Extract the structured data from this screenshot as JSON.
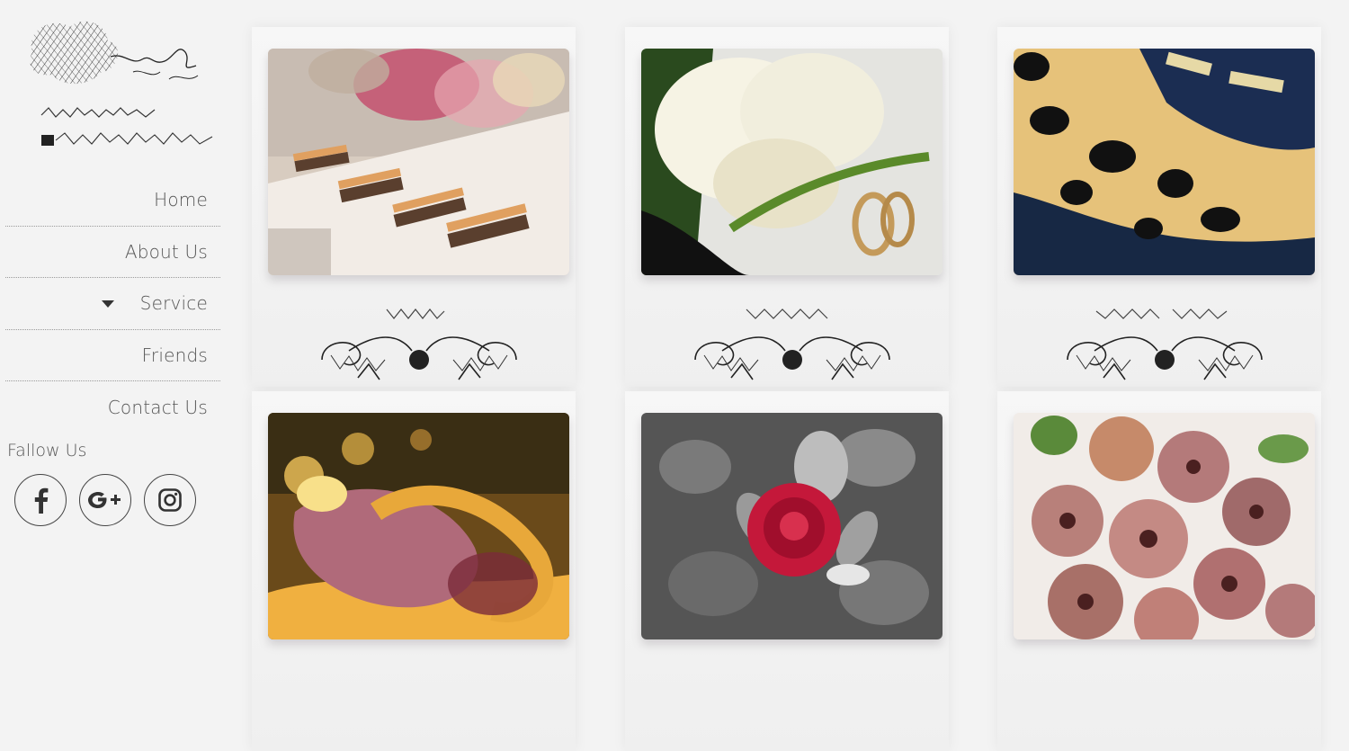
{
  "nav": {
    "items": [
      {
        "label": "Home",
        "has_dropdown": false
      },
      {
        "label": "About Us",
        "has_dropdown": false
      },
      {
        "label": "Service",
        "has_dropdown": true
      },
      {
        "label": "Friends",
        "has_dropdown": false
      },
      {
        "label": "Contact Us",
        "has_dropdown": false
      }
    ]
  },
  "follow": {
    "title": "Fallow Us",
    "icons": [
      "facebook-icon",
      "google-plus-icon",
      "instagram-icon"
    ]
  },
  "gallery": {
    "items": [
      {
        "subject": "dessert-table-flowers",
        "colors": [
          "#d9c9b8",
          "#c44a6a",
          "#4a4036"
        ]
      },
      {
        "subject": "white-rose-rings",
        "colors": [
          "#f4f1e3",
          "#3c6a2a",
          "#c79a5a"
        ]
      },
      {
        "subject": "navy-gold-fabric",
        "colors": [
          "#1b2d52",
          "#e6c27a",
          "#0e0e12"
        ]
      },
      {
        "subject": "candle-ribbon",
        "colors": [
          "#e8a83a",
          "#8a3a4a",
          "#f5d26a"
        ]
      },
      {
        "subject": "red-rose-grey",
        "colors": [
          "#c4183a",
          "#5a5a5a",
          "#9a9a9a"
        ]
      },
      {
        "subject": "pink-roses-bouquet",
        "colors": [
          "#b47a7a",
          "#5a8a3a",
          "#f1ece8"
        ]
      }
    ]
  },
  "colors": {
    "background": "#f3f3f3",
    "text": "#555555",
    "divider": "#9a9a9a"
  }
}
